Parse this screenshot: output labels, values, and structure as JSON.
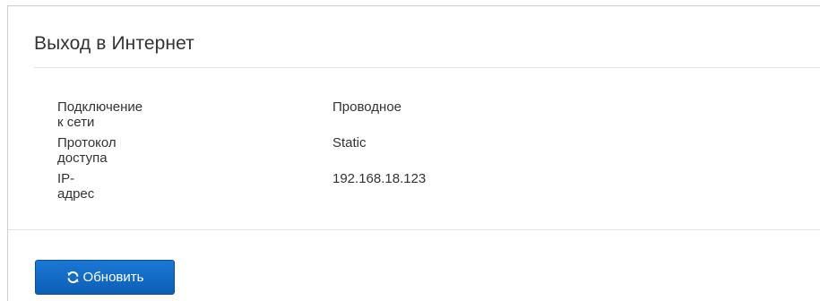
{
  "panel": {
    "title": "Выход в Интернет"
  },
  "info": {
    "rows": [
      {
        "label": "Подключение к сети",
        "value": "Проводное"
      },
      {
        "label": "Протокол доступа",
        "value": "Static"
      },
      {
        "label": "IP-адрес",
        "value": "192.168.18.123"
      }
    ]
  },
  "actions": {
    "refresh_label": "Обновить",
    "refresh_icon": "refresh-icon"
  },
  "colors": {
    "button": "#1a6fc9",
    "text": "#333333"
  }
}
